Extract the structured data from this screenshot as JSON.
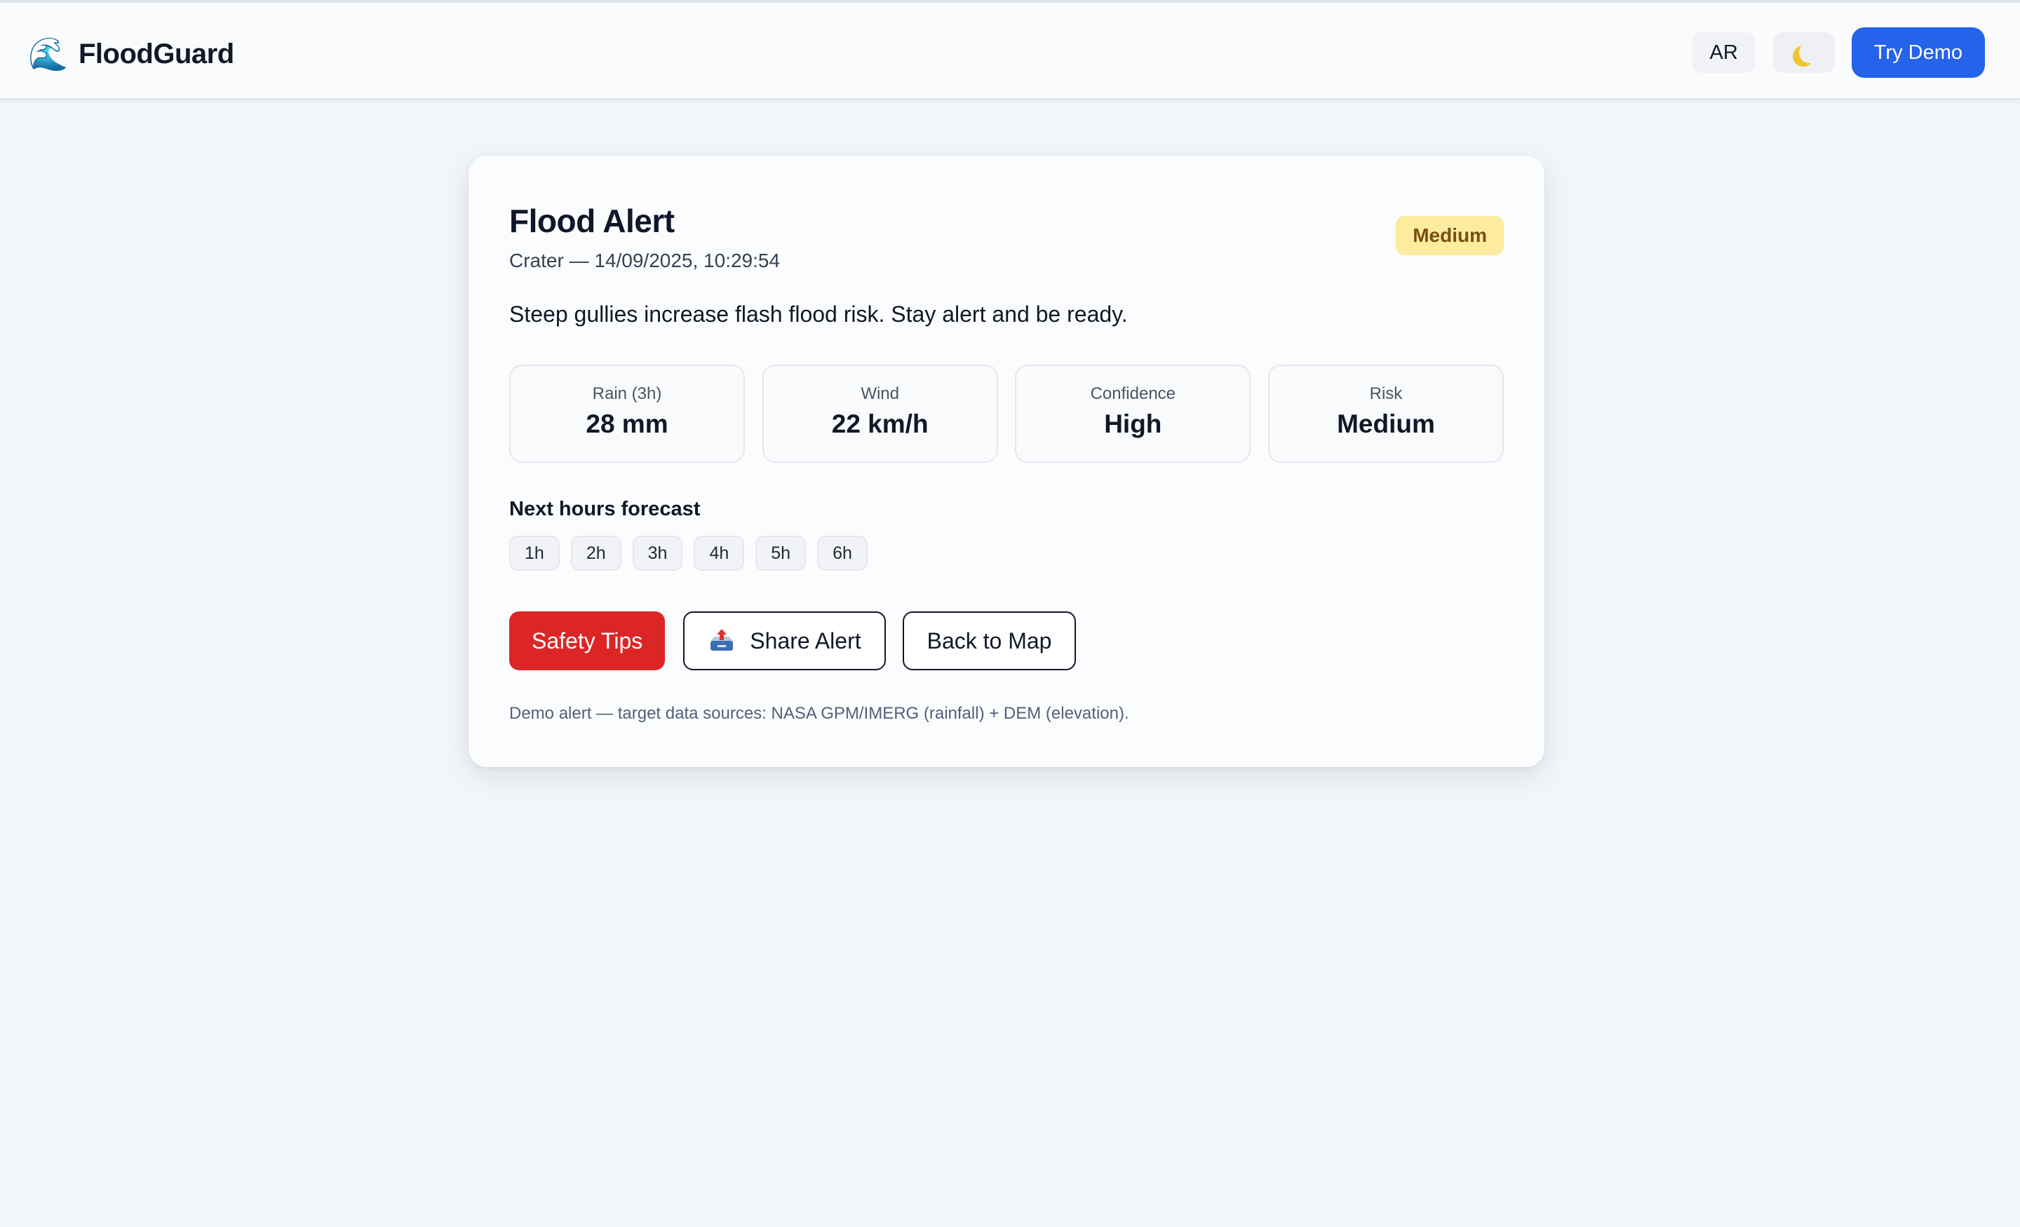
{
  "header": {
    "brand_icon": "wave-icon",
    "brand_name": "FloodGuard",
    "lang_button": "AR",
    "theme_icon": "moon-icon",
    "demo_button": "Try Demo"
  },
  "alert": {
    "title": "Flood Alert",
    "subtitle": "Crater — 14/09/2025, 10:29:54",
    "badge": "Medium",
    "message": "Steep gullies increase flash flood risk. Stay alert and be ready.",
    "stats": [
      {
        "label": "Rain (3h)",
        "value": "28 mm"
      },
      {
        "label": "Wind",
        "value": "22 km/h"
      },
      {
        "label": "Confidence",
        "value": "High"
      },
      {
        "label": "Risk",
        "value": "Medium"
      }
    ],
    "forecast_title": "Next hours forecast",
    "forecast_hours": [
      "1h",
      "2h",
      "3h",
      "4h",
      "5h",
      "6h"
    ],
    "actions": {
      "safety": "Safety Tips",
      "share": "Share Alert",
      "share_icon": "share-tray-icon",
      "back": "Back to Map"
    },
    "footnote": "Demo alert — target data sources: NASA GPM/IMERG (rainfall) + DEM (elevation)."
  },
  "colors": {
    "accent": "#2563eb",
    "danger": "#dc2626",
    "badge_bg": "#fdeba0",
    "badge_text": "#7a4e0c"
  }
}
